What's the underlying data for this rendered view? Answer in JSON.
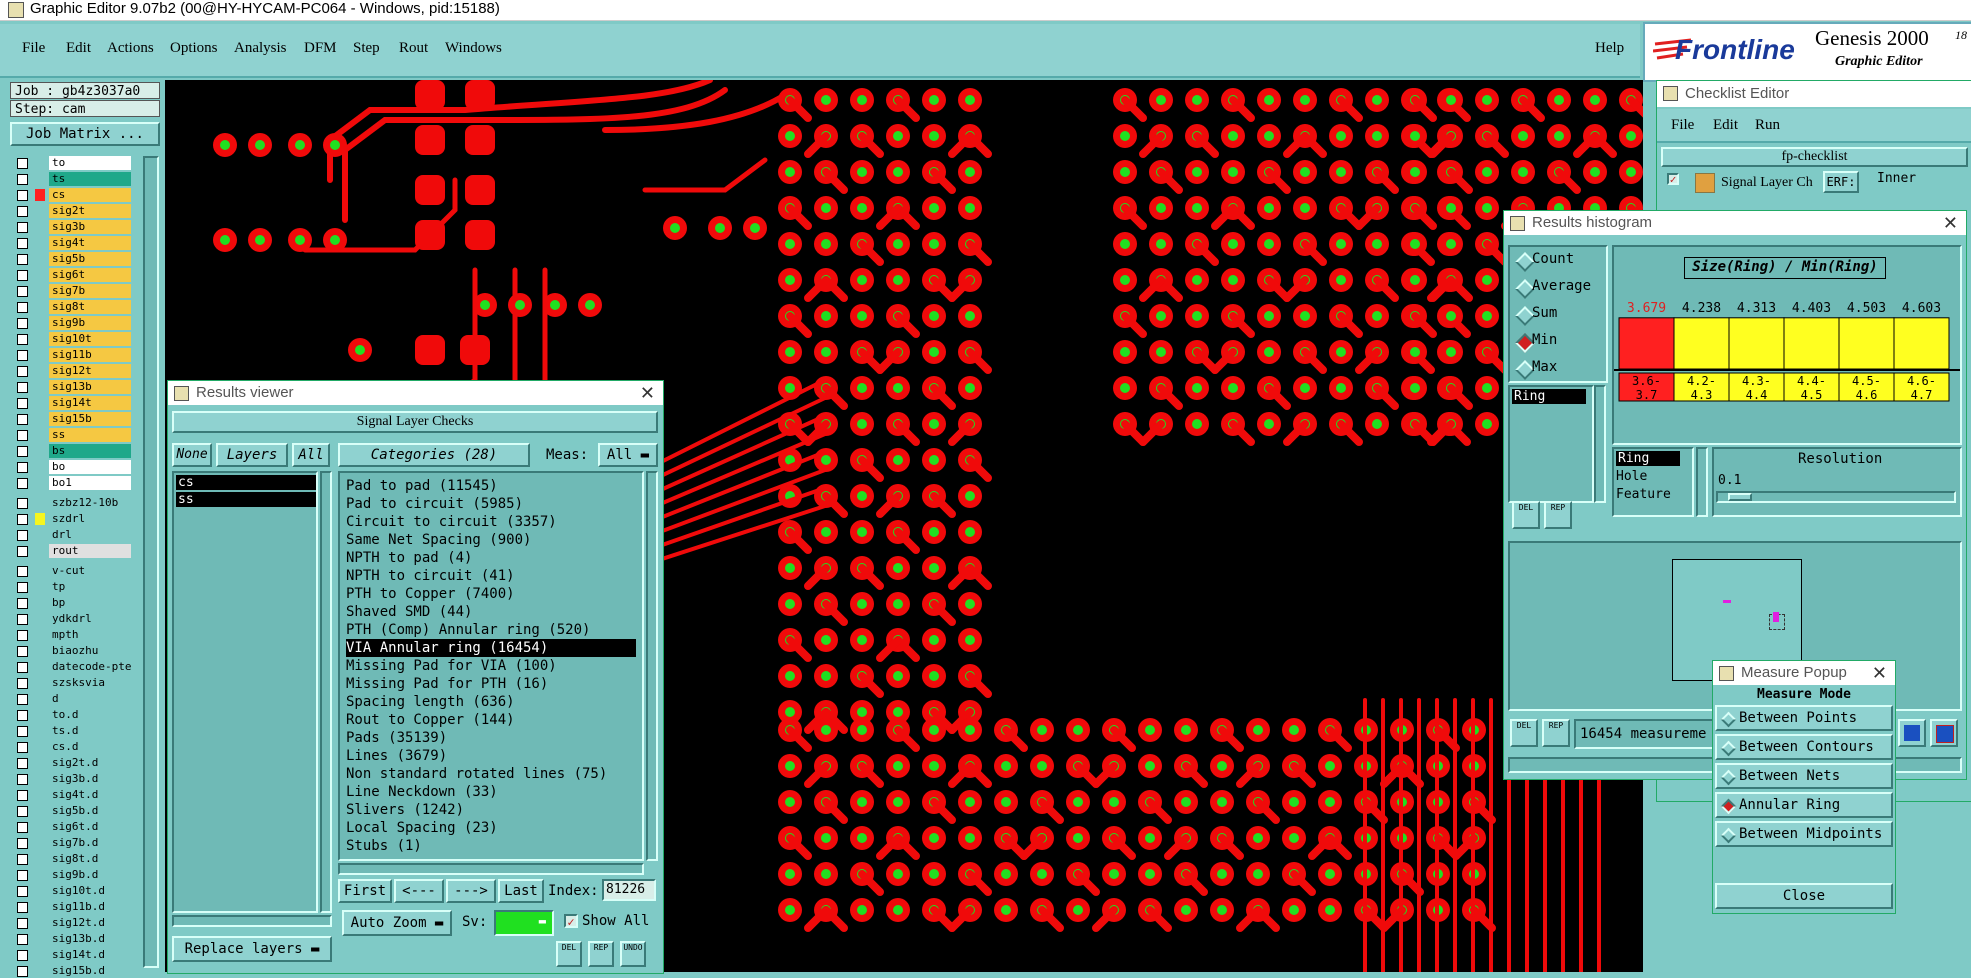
{
  "window_title": "Graphic Editor 9.07b2 (00@HY-HYCAM-PC064 - Windows, pid:15188)",
  "menu": [
    "File",
    "Edit",
    "Actions",
    "Options",
    "Analysis",
    "DFM",
    "Step",
    "Rout",
    "Windows"
  ],
  "help": "Help",
  "brand": {
    "logo": "Frontline",
    "product": "Genesis 2000",
    "subtitle": "Graphic Editor",
    "edge_marks": "18"
  },
  "job": {
    "job": "Job : gb4z3037a0",
    "step": "Step: cam",
    "matrix_button": "Job Matrix ..."
  },
  "layers_group1": [
    {
      "name": "to",
      "color": "#ffffff"
    },
    {
      "name": "ts",
      "color": "#1fa88a"
    },
    {
      "name": "cs",
      "color": "#f5c842",
      "mark": "#ff2020"
    },
    {
      "name": "sig2t",
      "color": "#f5c842"
    },
    {
      "name": "sig3b",
      "color": "#f5c842"
    },
    {
      "name": "sig4t",
      "color": "#f5c842"
    },
    {
      "name": "sig5b",
      "color": "#f5c842"
    },
    {
      "name": "sig6t",
      "color": "#f5c842"
    },
    {
      "name": "sig7b",
      "color": "#f5c842"
    },
    {
      "name": "sig8t",
      "color": "#f5c842"
    },
    {
      "name": "sig9b",
      "color": "#f5c842"
    },
    {
      "name": "sig10t",
      "color": "#f5c842"
    },
    {
      "name": "sig11b",
      "color": "#f5c842"
    },
    {
      "name": "sig12t",
      "color": "#f5c842"
    },
    {
      "name": "sig13b",
      "color": "#f5c842"
    },
    {
      "name": "sig14t",
      "color": "#f5c842"
    },
    {
      "name": "sig15b",
      "color": "#f5c842"
    },
    {
      "name": "ss",
      "color": "#f5c842"
    },
    {
      "name": "bs",
      "color": "#1fa88a"
    },
    {
      "name": "bo",
      "color": "#ffffff"
    },
    {
      "name": "bo1",
      "color": "#ffffff"
    }
  ],
  "layers_group2": [
    {
      "name": "szbz12-10b",
      "color": "#7fcac6"
    },
    {
      "name": "szdrl",
      "color": "#7fcac6",
      "mark": "#f5f520"
    },
    {
      "name": "drl",
      "color": "#7fcac6"
    },
    {
      "name": "rout",
      "color": "#e0e0e0"
    }
  ],
  "layers_group3": [
    "v-cut",
    "tp",
    "bp",
    "ydkdrl",
    "mpth",
    "biaozhu",
    "datecode-pte",
    "szsksvia",
    "d",
    "to.d",
    "ts.d",
    "cs.d",
    "sig2t.d",
    "sig3b.d",
    "sig4t.d",
    "sig5b.d",
    "sig6t.d",
    "sig7b.d",
    "sig8t.d",
    "sig9b.d",
    "sig10t.d",
    "sig11b.d",
    "sig12t.d",
    "sig13b.d",
    "sig14t.d",
    "sig15b.d"
  ],
  "results_viewer": {
    "title": "Results viewer",
    "header": "Signal Layer Checks",
    "none": "None",
    "layers": "Layers",
    "all": "All",
    "selected_layers": [
      "cs",
      "ss"
    ],
    "categories_label": "Categories (28)",
    "meas_label": "Meas:",
    "meas_value": "All",
    "categories": [
      "Pad to pad (11545)",
      "Pad to circuit (5985)",
      "Circuit to circuit (3357)",
      "Same Net Spacing (900)",
      "NPTH to pad (4)",
      "NPTH to circuit (41)",
      "PTH to Copper (7400)",
      "Shaved SMD (44)",
      "PTH (Comp) Annular ring (520)",
      "VIA Annular ring (16454)",
      "Missing Pad for VIA (100)",
      "Missing Pad for PTH (16)",
      "Spacing length (636)",
      "Rout to Copper (144)",
      "Pads (35139)",
      "Lines (3679)",
      "Non standard rotated lines (75)",
      "Line Neckdown (33)",
      "Slivers (1242)",
      "Local Spacing (23)",
      "Stubs (1)"
    ],
    "selected_category": 9,
    "nav": {
      "first": "First",
      "prev": "<---",
      "next": "--->",
      "last": "Last",
      "index_label": "Index:",
      "index_value": "81226"
    },
    "zoom": "Auto Zoom",
    "sv": "Sv:",
    "show_all": "Show All",
    "replace_layers": "Replace layers",
    "small_buttons": [
      "DEL",
      "REP",
      "UNDO"
    ]
  },
  "checklist_editor": {
    "title": "Checklist Editor",
    "menu": [
      "File",
      "Edit",
      "Run"
    ],
    "name": "fp-checklist",
    "row_label": "Signal Layer Ch",
    "erf": "ERF:",
    "erf_value": "Inner"
  },
  "results_histogram": {
    "title": "Results histogram",
    "modes": [
      "Count",
      "Average",
      "Sum",
      "Min",
      "Max"
    ],
    "selected_mode": "Min",
    "attr_list": [
      "Ring"
    ],
    "chart_title": "Size(Ring) / Min(Ring)",
    "attrs2": [
      "Ring",
      "Hole",
      "Feature"
    ],
    "resolution_label": "Resolution",
    "resolution_value": "0.1",
    "buttons": [
      "DEL",
      "REP"
    ],
    "status": "16454 measureme"
  },
  "chart_data": {
    "type": "bar",
    "title": "Size(Ring) / Min(Ring)",
    "categories": [
      "3.6-\n3.7",
      "4.2-\n4.3",
      "4.3-\n4.4",
      "4.4-\n4.5",
      "4.5-\n4.6",
      "4.6-\n4.7"
    ],
    "category_labels": [
      "3.6-",
      "4.2-",
      "4.3-",
      "4.4-",
      "4.5-",
      "4.6-"
    ],
    "category_labels2": [
      "3.7",
      "4.3",
      "4.4",
      "4.5",
      "4.6",
      "4.7"
    ],
    "values": [
      3.679,
      4.238,
      4.313,
      4.403,
      4.503,
      4.603
    ],
    "value_labels": [
      "3.679",
      "4.238",
      "4.313",
      "4.403",
      "4.503",
      "4.603"
    ],
    "bar_colors": [
      "#ff2020",
      "#ffff20",
      "#ffff20",
      "#ffff20",
      "#ffff20",
      "#ffff20"
    ],
    "ylim": [
      0,
      4.603
    ]
  },
  "measure_popup": {
    "title": "Measure Popup",
    "mode_label": "Measure Mode",
    "modes": [
      "Between Points",
      "Between Contours",
      "Between Nets",
      "Annular Ring",
      "Between Midpoints"
    ],
    "selected": "Annular Ring",
    "close": "Close"
  }
}
